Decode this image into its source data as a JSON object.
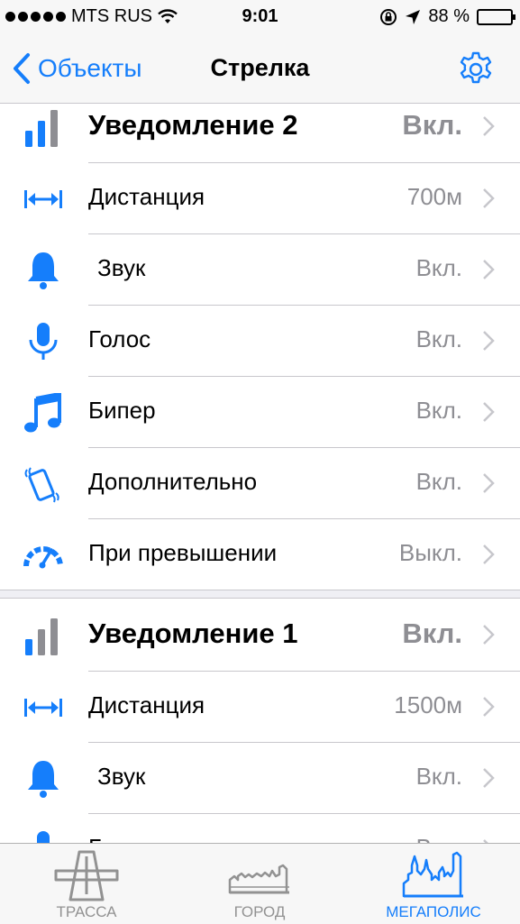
{
  "status_bar": {
    "carrier": "MTS RUS",
    "time": "9:01",
    "battery": "88 %",
    "battery_level": 0.88
  },
  "nav": {
    "back_label": "Объекты",
    "title": "Стрелка"
  },
  "groups": [
    {
      "header": {
        "label": "Уведомление 2",
        "value": "Вкл."
      },
      "rows": [
        {
          "label": "Дистанция",
          "value": "700м",
          "icon": "distance-icon"
        },
        {
          "label": "Звук",
          "value": "Вкл.",
          "icon": "bell-icon"
        },
        {
          "label": "Голос",
          "value": "Вкл.",
          "icon": "microphone-icon"
        },
        {
          "label": "Бипер",
          "value": "Вкл.",
          "icon": "music-note-icon"
        },
        {
          "label": "Дополнительно",
          "value": "Вкл.",
          "icon": "phone-vibrate-icon"
        },
        {
          "label": "При превышении",
          "value": "Выкл.",
          "icon": "speedometer-icon"
        }
      ]
    },
    {
      "header": {
        "label": "Уведомление 1",
        "value": "Вкл."
      },
      "rows": [
        {
          "label": "Дистанция",
          "value": "1500м",
          "icon": "distance-icon"
        },
        {
          "label": "Звук",
          "value": "Вкл.",
          "icon": "bell-icon"
        },
        {
          "label": "Голос",
          "value": "Вкл.",
          "icon": "microphone-icon"
        }
      ]
    }
  ],
  "tabs": [
    {
      "label": "ТРАССА",
      "icon": "highway-icon",
      "active": false
    },
    {
      "label": "ГОРОД",
      "icon": "town-skyline-icon",
      "active": false
    },
    {
      "label": "МЕГАПОЛИС",
      "icon": "city-skyline-icon",
      "active": true
    }
  ],
  "colors": {
    "accent": "#157efb",
    "secondary_text": "#8e8e93",
    "separator": "#c8c7cc",
    "tab_inactive": "#929292"
  }
}
